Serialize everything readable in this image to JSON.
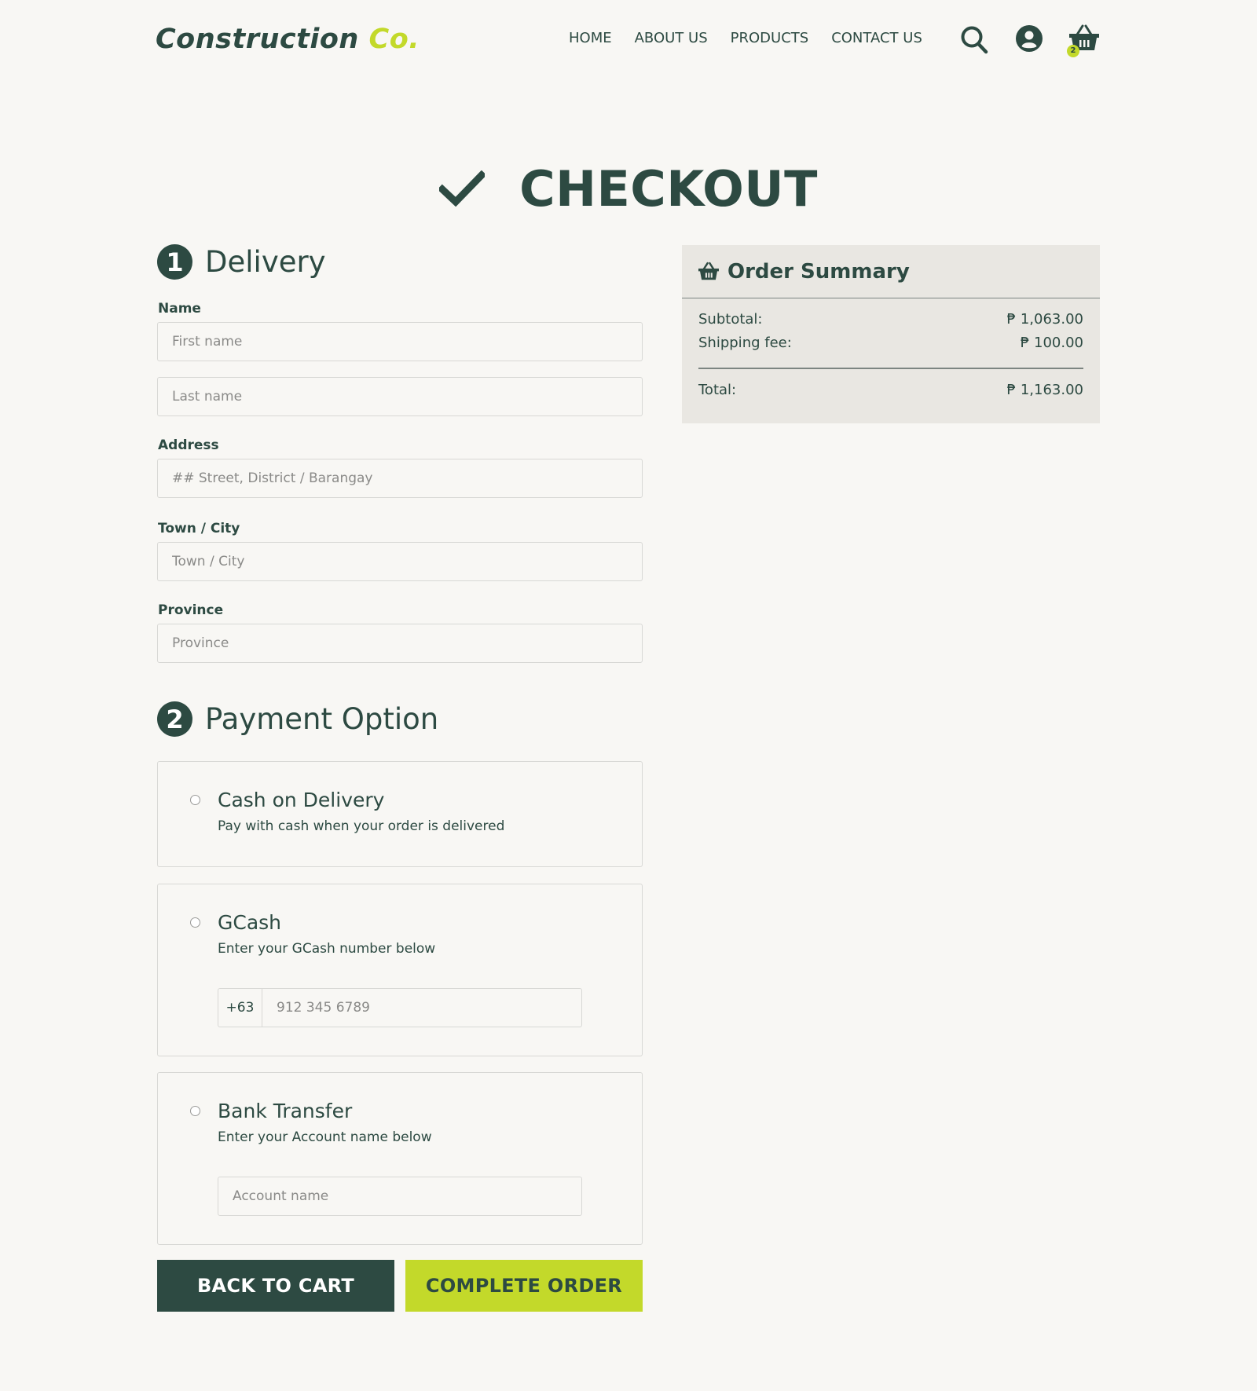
{
  "brand": {
    "name": "Construction",
    "suffix": "Co."
  },
  "nav": {
    "items": [
      "HOME",
      "ABOUT US",
      "PRODUCTS",
      "CONTACT US"
    ],
    "cart_count": "2"
  },
  "page": {
    "title": "CHECKOUT"
  },
  "delivery": {
    "number": "1",
    "title": "Delivery",
    "name_label": "Name",
    "first_name_placeholder": "First name",
    "last_name_placeholder": "Last name",
    "address_label": "Address",
    "address_placeholder": "## Street, District / Barangay",
    "city_label": "Town / City",
    "city_placeholder": "Town / City",
    "province_label": "Province",
    "province_placeholder": "Province"
  },
  "payment": {
    "number": "2",
    "title": "Payment Option",
    "options": [
      {
        "title": "Cash on Delivery",
        "description": "Pay with cash when your order is delivered"
      },
      {
        "title": "GCash",
        "description": "Enter your GCash number below",
        "prefix": "+63",
        "placeholder": "912 345 6789"
      },
      {
        "title": "Bank Transfer",
        "description": "Enter your Account name below",
        "placeholder": "Account name"
      }
    ]
  },
  "actions": {
    "back": "BACK TO CART",
    "complete": "COMPLETE ORDER"
  },
  "summary": {
    "title": "Order Summary",
    "subtotal_label": "Subtotal:",
    "subtotal_value": "₱ 1,063.00",
    "shipping_label": "Shipping fee:",
    "shipping_value": "₱ 100.00",
    "total_label": "Total:",
    "total_value": "₱ 1,163.00"
  },
  "colors": {
    "primary": "#2d4a42",
    "accent": "#c3d92a",
    "background": "#f8f7f4",
    "summary_bg": "#e9e7e2"
  },
  "icons": [
    "search-icon",
    "user-icon",
    "cart-icon",
    "checkmark-icon",
    "basket-icon"
  ]
}
